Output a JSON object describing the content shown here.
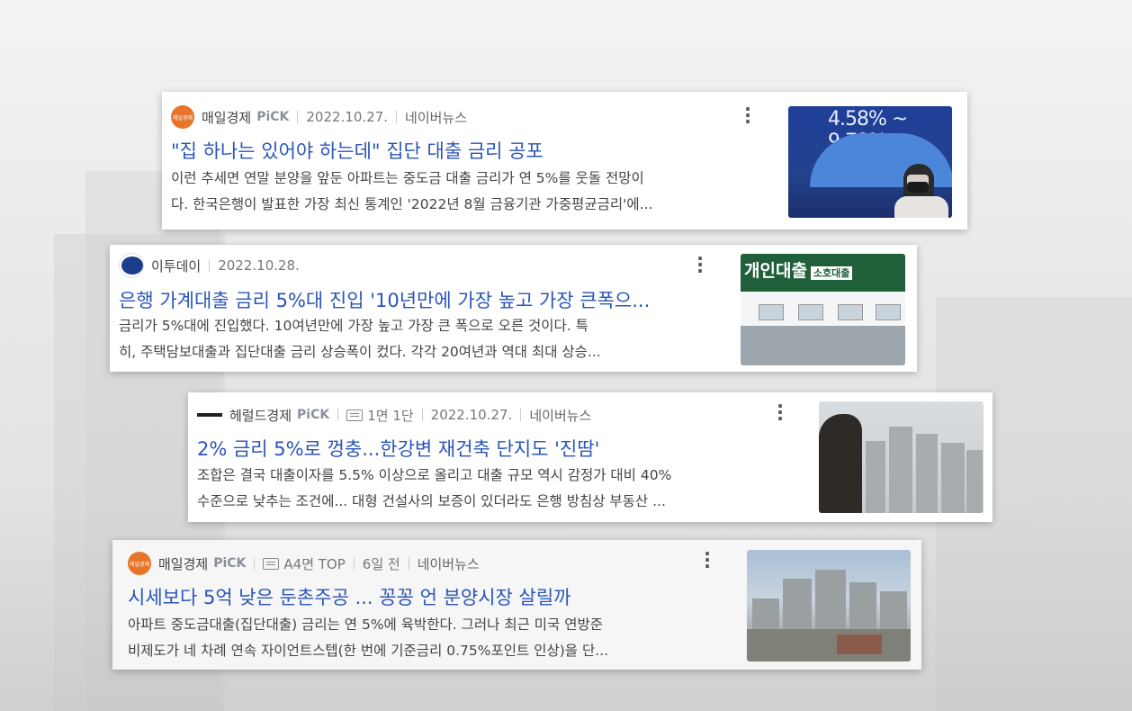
{
  "cards": [
    {
      "publisher": "매일경제",
      "pick": "PiCK",
      "date": "2022.10.27.",
      "source": "네이버뉴스",
      "title": "\"집 하나는 있어야 하는데\" 집단 대출 금리 공포",
      "desc_line1": "이런 추세면 연말 분양을 앞둔 아파트는 중도금 대출 금리가 연 5%를 웃돌 전망이",
      "desc_line2": "다. 한국은행이 발표한 가장 최신 통계인 '2022년 8월 금융기관 가중평균금리'에...",
      "thumb_text": "4.58% ~ 9.78%",
      "logo_text": "매일경제"
    },
    {
      "publisher": "이투데이",
      "date": "2022.10.28.",
      "title": "은행 가계대출 금리 5%대 진입 '10년만에 가장 높고 가장 큰폭으...",
      "desc_line1": "금리가 5%대에 진입했다. 10여년만에 가장 높고 가장 큰 폭으로 오른 것이다. 특",
      "desc_line2": "히, 주택담보대출과 집단대출 금리 상승폭이 컸다. 각각 20여년과 역대 최대 상승...",
      "thumb_text": "개인대출",
      "thumb_small": "소호대출"
    },
    {
      "publisher": "헤럴드경제",
      "pick": "PiCK",
      "page": "1면 1단",
      "date": "2022.10.27.",
      "source": "네이버뉴스",
      "title": "2% 금리 5%로 껑충...한강변 재건축 단지도 '진땀'",
      "desc_line1": "조합은 결국 대출이자를 5.5% 이상으로 올리고 대출 규모 역시 감정가 대비 40%",
      "desc_line2": "수준으로 낮추는 조건에... 대형 건설사의 보증이 있더라도 은행 방침상 부동산 ..."
    },
    {
      "publisher": "매일경제",
      "pick": "PiCK",
      "page": "A4면 TOP",
      "date": "6일 전",
      "source": "네이버뉴스",
      "title": "시세보다 5억 낮은 둔촌주공 ... 꽁꽁 언 분양시장 살릴까",
      "desc_line1": "아파트 중도금대출(집단대출) 금리는 연 5%에 육박한다. 그러나 최근 미국 연방준",
      "desc_line2": "비제도가 네 차례 연속 자이언트스텝(한 번에 기준금리 0.75%포인트 인상)을 단...",
      "logo_text": "매일경제"
    }
  ],
  "colors": {
    "title_link": "#2a55b8",
    "mk_logo": "#e8742a",
    "et_logo": "#1b3d8c"
  },
  "icons": {
    "more": "more-vertical-icon",
    "paper": "newspaper-icon"
  }
}
